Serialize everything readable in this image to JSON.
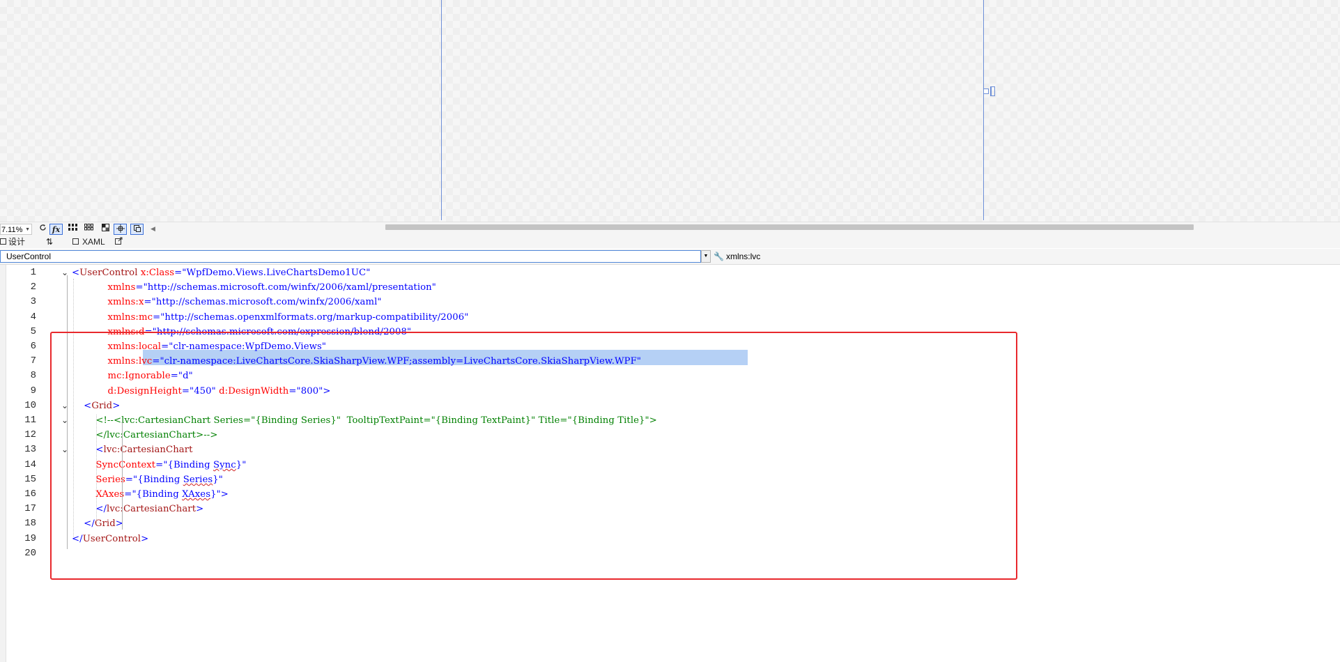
{
  "designer": {},
  "toolbar": {
    "zoom": "7.11%",
    "refresh_icon": "refresh-icon",
    "fx_label": "fx",
    "grid_icon": "grid-icon",
    "snap_icon": "snap-grid-icon",
    "background_icon": "background-icon",
    "snap_lines_icon": "snap-lines-icon",
    "device_icon": "device-icon",
    "collapse_icon": "triangle-left-icon"
  },
  "tabs": {
    "design_label": "设计",
    "swap_label": "⇅",
    "xaml_label": "XAML"
  },
  "navbar": {
    "element": "UserControl",
    "member": "xmlns:lvc"
  },
  "editor": {
    "line_numbers": [
      "1",
      "2",
      "3",
      "4",
      "5",
      "6",
      "7",
      "8",
      "9",
      "10",
      "11",
      "12",
      "13",
      "14",
      "15",
      "16",
      "17",
      "18",
      "19",
      "20"
    ],
    "lines": [
      [
        [
          "br",
          "<"
        ],
        [
          "tag",
          "UserControl"
        ],
        [
          "plain",
          " "
        ],
        [
          "attr",
          "x:Class"
        ],
        [
          "br",
          "=\""
        ],
        [
          "val",
          "WpfDemo.Views.LiveChartsDemo1UC"
        ],
        [
          "br",
          "\""
        ]
      ],
      [
        [
          "plain",
          "            "
        ],
        [
          "attr",
          "xmlns"
        ],
        [
          "br",
          "=\""
        ],
        [
          "val",
          "http://schemas.microsoft.com/winfx/2006/xaml/presentation"
        ],
        [
          "br",
          "\""
        ]
      ],
      [
        [
          "plain",
          "            "
        ],
        [
          "attr",
          "xmlns:x"
        ],
        [
          "br",
          "=\""
        ],
        [
          "val",
          "http://schemas.microsoft.com/winfx/2006/xaml"
        ],
        [
          "br",
          "\""
        ]
      ],
      [
        [
          "plain",
          "            "
        ],
        [
          "attr",
          "xmlns:mc"
        ],
        [
          "br",
          "=\""
        ],
        [
          "val",
          "http://schemas.openxmlformats.org/markup-compatibility/2006"
        ],
        [
          "br",
          "\""
        ]
      ],
      [
        [
          "plain",
          "            "
        ],
        [
          "attr",
          "xmlns:d"
        ],
        [
          "br",
          "=\""
        ],
        [
          "val",
          "http://schemas.microsoft.com/expression/blend/2008"
        ],
        [
          "br",
          "\""
        ]
      ],
      [
        [
          "plain",
          "            "
        ],
        [
          "attr",
          "xmlns:local"
        ],
        [
          "br",
          "=\""
        ],
        [
          "val",
          "clr-namespace:WpfDemo.Views"
        ],
        [
          "br",
          "\""
        ]
      ],
      [
        [
          "plain",
          "            "
        ],
        [
          "attr",
          "xmlns:lvc"
        ],
        [
          "br",
          "=\""
        ],
        [
          "val",
          "clr-namespace:LiveChartsCore.SkiaSharpView.WPF;assembly=LiveChartsCore.SkiaSharpView.WPF"
        ],
        [
          "br",
          "\""
        ]
      ],
      [
        [
          "plain",
          "            "
        ],
        [
          "attr",
          "mc:Ignorable"
        ],
        [
          "br",
          "=\""
        ],
        [
          "val",
          "d"
        ],
        [
          "br",
          "\""
        ]
      ],
      [
        [
          "plain",
          "            "
        ],
        [
          "attr",
          "d:DesignHeight"
        ],
        [
          "br",
          "=\""
        ],
        [
          "val",
          "450"
        ],
        [
          "br",
          "\" "
        ],
        [
          "attr",
          "d:DesignWidth"
        ],
        [
          "br",
          "=\""
        ],
        [
          "val",
          "800"
        ],
        [
          "br",
          "\">"
        ]
      ],
      [
        [
          "plain",
          "    "
        ],
        [
          "br",
          "<"
        ],
        [
          "tag",
          "Grid"
        ],
        [
          "br",
          ">"
        ]
      ],
      [
        [
          "plain",
          "        "
        ],
        [
          "com",
          "<!--<lvc:CartesianChart Series=\"{Binding Series}\"  TooltipTextPaint=\"{Binding TextPaint}\" Title=\"{Binding Title}\">"
        ]
      ],
      [
        [
          "plain",
          "        "
        ],
        [
          "com",
          "</lvc:CartesianChart>-->"
        ]
      ],
      [
        [
          "plain",
          "        "
        ],
        [
          "br",
          "<"
        ],
        [
          "tag",
          "lvc:CartesianChart"
        ]
      ],
      [
        [
          "plain",
          "        "
        ],
        [
          "attr",
          "SyncContext"
        ],
        [
          "br",
          "=\""
        ],
        [
          "val",
          "{Binding "
        ],
        [
          "valsq",
          "Sync"
        ],
        [
          "val",
          "}"
        ],
        [
          "br",
          "\""
        ]
      ],
      [
        [
          "plain",
          "        "
        ],
        [
          "attr",
          "Series"
        ],
        [
          "br",
          "=\""
        ],
        [
          "val",
          "{Binding "
        ],
        [
          "valsq",
          "Series"
        ],
        [
          "val",
          "}"
        ],
        [
          "br",
          "\""
        ]
      ],
      [
        [
          "plain",
          "        "
        ],
        [
          "attr",
          "XAxes"
        ],
        [
          "br",
          "=\""
        ],
        [
          "val",
          "{Binding "
        ],
        [
          "valsq",
          "XAxes"
        ],
        [
          "val",
          "}"
        ],
        [
          "br",
          "\">"
        ]
      ],
      [
        [
          "plain",
          "        "
        ],
        [
          "br",
          "</"
        ],
        [
          "tag",
          "lvc:CartesianChart"
        ],
        [
          "br",
          ">"
        ]
      ],
      [
        [
          "plain",
          "    "
        ],
        [
          "br",
          "</"
        ],
        [
          "tag",
          "Grid"
        ],
        [
          "br",
          ">"
        ]
      ],
      [
        [
          "br",
          "</"
        ],
        [
          "tag",
          "UserControl"
        ],
        [
          "br",
          ">"
        ]
      ],
      []
    ]
  },
  "colors": {
    "tag": "#a31515",
    "attr": "#ff0000",
    "value": "#0000ff",
    "comment": "#008000",
    "selection": "#b5d0f5",
    "annotation_box": "#e8282c"
  }
}
